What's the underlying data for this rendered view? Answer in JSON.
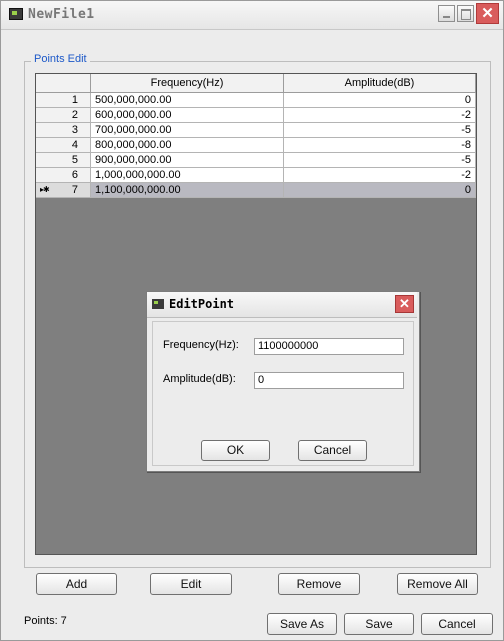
{
  "window": {
    "title": "NewFile1",
    "close_glyph": "✕"
  },
  "group": {
    "legend": "Points Edit"
  },
  "table": {
    "columns": [
      "",
      "Frequency(Hz)",
      "Amplitude(dB)"
    ],
    "rows": [
      {
        "index": "1",
        "frequency": "500,000,000.00",
        "amplitude": "0"
      },
      {
        "index": "2",
        "frequency": "600,000,000.00",
        "amplitude": "-2"
      },
      {
        "index": "3",
        "frequency": "700,000,000.00",
        "amplitude": "-5"
      },
      {
        "index": "4",
        "frequency": "800,000,000.00",
        "amplitude": "-8"
      },
      {
        "index": "5",
        "frequency": "900,000,000.00",
        "amplitude": "-5"
      },
      {
        "index": "6",
        "frequency": "1,000,000,000.00",
        "amplitude": "-2"
      },
      {
        "index": "7",
        "frequency": "1,100,000,000.00",
        "amplitude": "0",
        "marker": "▸✱"
      }
    ]
  },
  "dialog": {
    "title": "EditPoint",
    "close_glyph": "✕",
    "frequency_label": "Frequency(Hz):",
    "frequency_value": "1100000000",
    "amplitude_label": "Amplitude(dB):",
    "amplitude_value": "0",
    "ok_label": "OK",
    "cancel_label": "Cancel"
  },
  "buttons": {
    "add": "Add",
    "edit": "Edit",
    "remove": "Remove",
    "remove_all": "Remove All",
    "save_as": "Save As",
    "save": "Save",
    "cancel": "Cancel"
  },
  "status": {
    "points": "Points: 7"
  },
  "colors": {
    "legend_text": "#1c58c8",
    "close_button": "#d95c5c",
    "grid_background": "#7f7f7f",
    "selected_row": "#b9b9c1"
  }
}
